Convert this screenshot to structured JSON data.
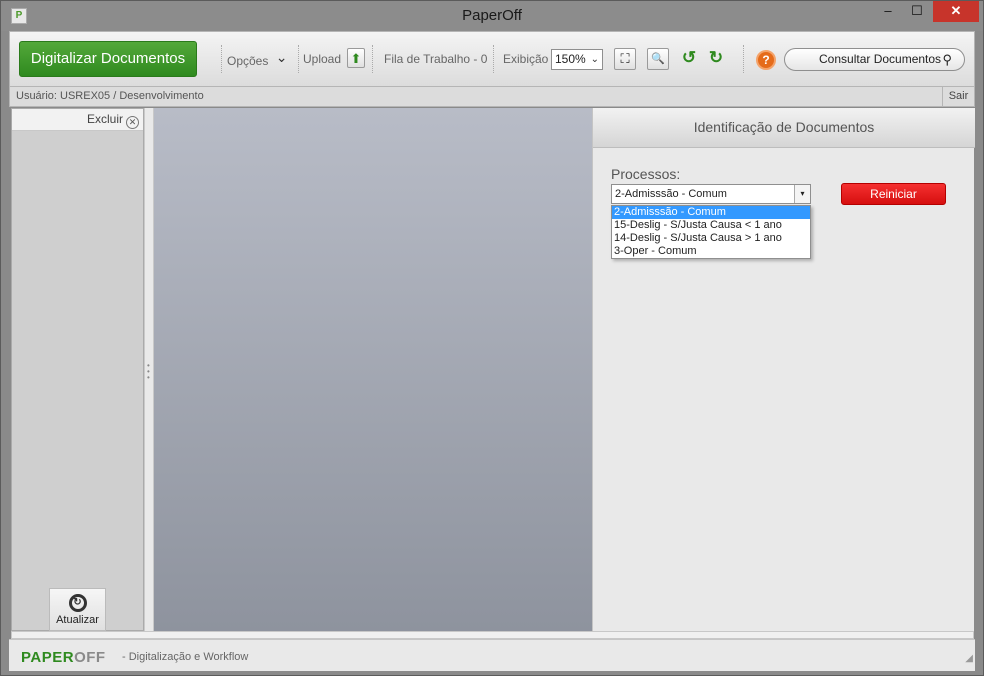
{
  "window": {
    "title": "PaperOff",
    "icon_text": "P",
    "minimize": "‒",
    "maximize": "☐",
    "close": "✕"
  },
  "toolbar": {
    "scan_label": "Digitalizar Documentos",
    "options_label": "Opções",
    "options_chevron": "⌄",
    "upload_label": "Upload",
    "upload_icon": "⬆",
    "queue_label": "Fila de Trabalho - 0",
    "zoom_label": "Exibição",
    "zoom_value": "150%",
    "zoom_arrow": "⌄",
    "fit_icon": "⛶",
    "search_icon": "🔍",
    "rotate_left_icon": "↺",
    "rotate_right_icon": "↻",
    "help_icon": "?",
    "consult_label": "Consultar Documentos",
    "consult_icon": "⚲"
  },
  "userbar": {
    "user_text": "Usuário: USREX05 / Desenvolvimento",
    "logout_label": "Sair"
  },
  "left_panel": {
    "delete_label": "Excluir",
    "delete_icon": "✕",
    "refresh_icon": "↻",
    "refresh_label": "Atualizar"
  },
  "right_panel": {
    "header": "Identificação de Documentos",
    "process_label": "Processos:",
    "process_selected": "2-Admisssão - Comum",
    "process_arrow": "▾",
    "process_options": [
      "2-Admisssão - Comum",
      "15-Deslig - S/Justa Causa < 1 ano",
      "14-Deslig - S/Justa Causa > 1 ano",
      "3-Oper - Comum"
    ],
    "restart_label": "Reiniciar"
  },
  "footer": {
    "logo_paper": "PAPER",
    "logo_off": "OFF",
    "tagline": "- Digitalização e Workflow"
  },
  "colors": {
    "brand_green": "#2f8a1f",
    "restart_red": "#e01414",
    "selection_blue": "#3399ff",
    "close_red": "#c7342b"
  }
}
